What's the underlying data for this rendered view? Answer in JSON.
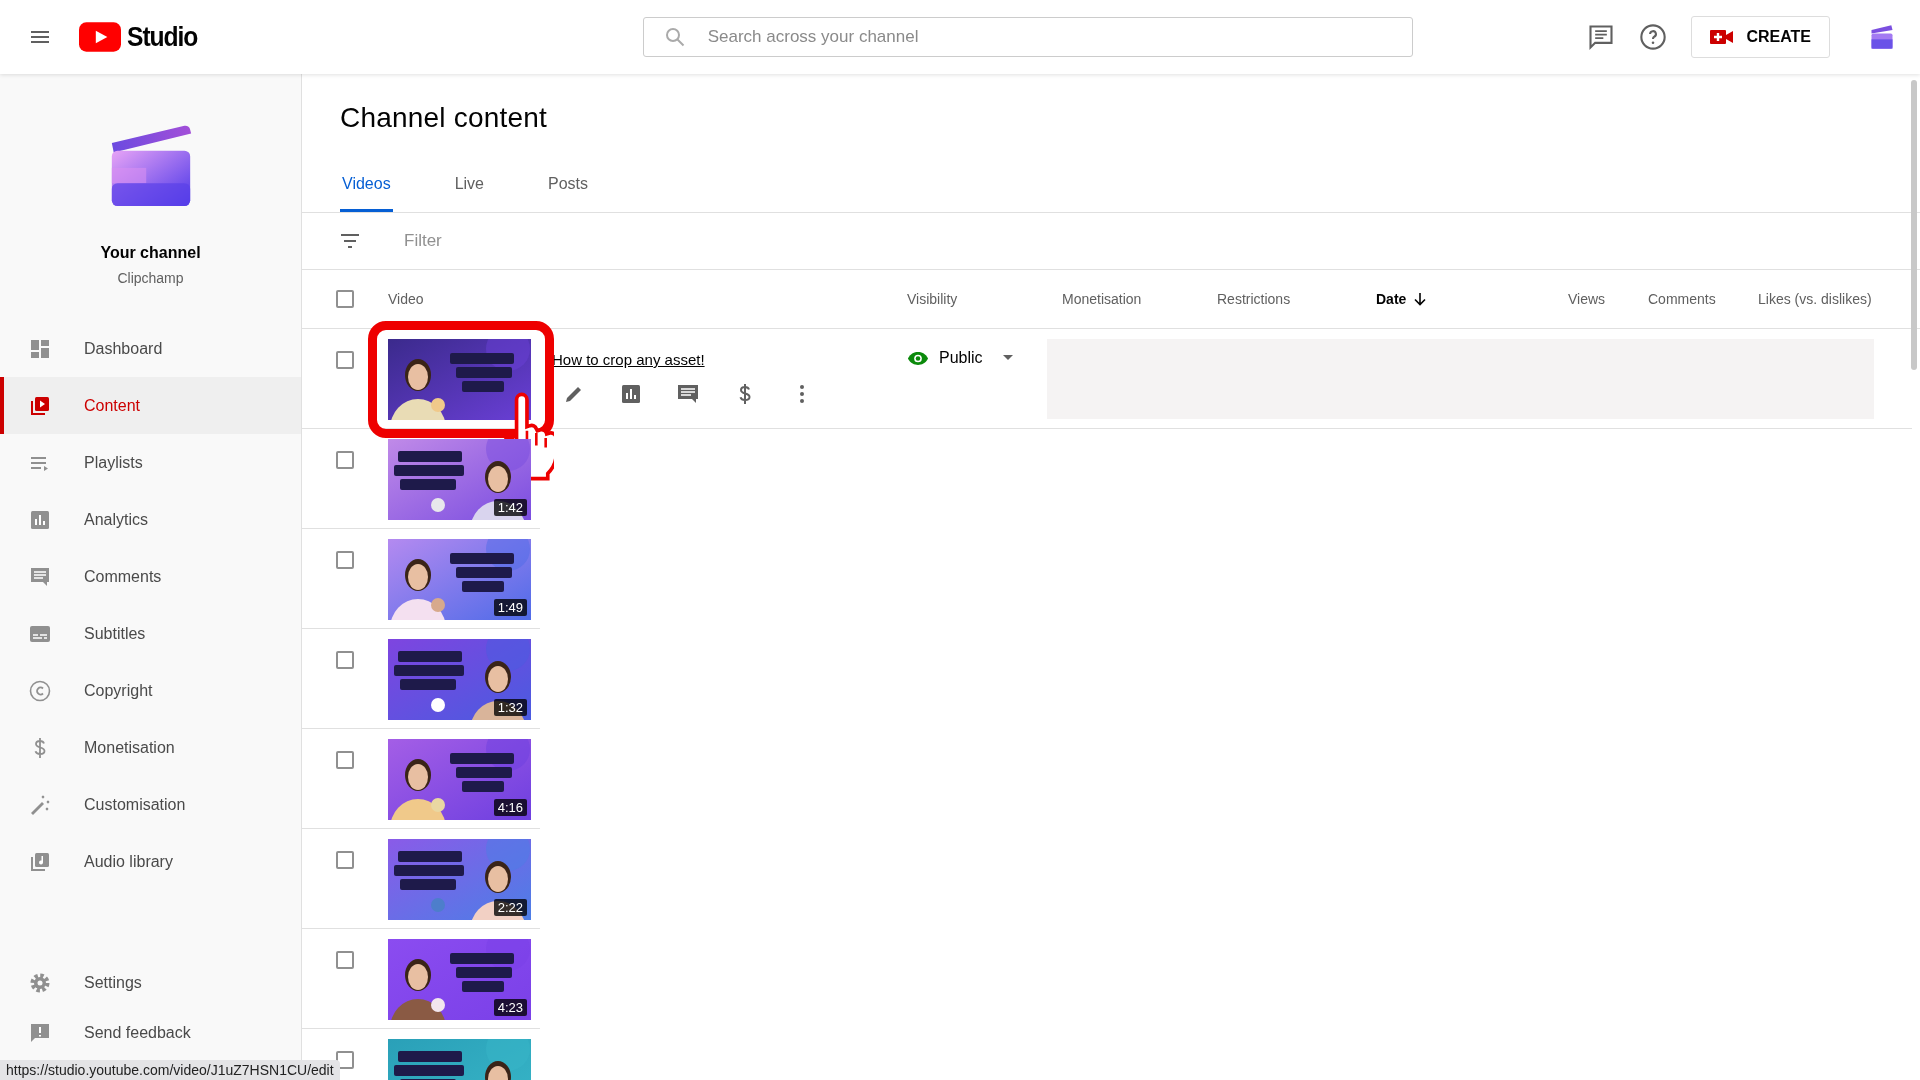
{
  "header": {
    "brand": "Studio",
    "search": {
      "placeholder": "Search across your channel"
    },
    "create_button": "CREATE"
  },
  "channel": {
    "name": "Your channel",
    "handle": "Clipchamp"
  },
  "sidebar": {
    "items": [
      {
        "label": "Dashboard",
        "selected": false
      },
      {
        "label": "Content",
        "selected": true
      },
      {
        "label": "Playlists",
        "selected": false
      },
      {
        "label": "Analytics",
        "selected": false
      },
      {
        "label": "Comments",
        "selected": false
      },
      {
        "label": "Subtitles",
        "selected": false
      },
      {
        "label": "Copyright",
        "selected": false
      },
      {
        "label": "Monetisation",
        "selected": false
      },
      {
        "label": "Customisation",
        "selected": false
      },
      {
        "label": "Audio library",
        "selected": false
      }
    ],
    "footer_items": [
      {
        "label": "Settings"
      },
      {
        "label": "Send feedback"
      }
    ]
  },
  "page": {
    "title": "Channel content",
    "tabs": [
      {
        "label": "Videos",
        "selected": true
      },
      {
        "label": "Live",
        "selected": false
      },
      {
        "label": "Posts",
        "selected": false
      }
    ],
    "filter": {
      "placeholder": "Filter"
    }
  },
  "table": {
    "select_all": {
      "checked": false
    },
    "columns": [
      {
        "label": "Video",
        "sorted": false
      },
      {
        "label": "Visibility",
        "sorted": false
      },
      {
        "label": "Monetisation",
        "sorted": false
      },
      {
        "label": "Restrictions",
        "sorted": false
      },
      {
        "label": "Date",
        "sorted": true
      },
      {
        "label": "Views",
        "sorted": false
      },
      {
        "label": "Comments",
        "sorted": false
      },
      {
        "label": "Likes (vs. dislikes)",
        "sorted": false
      }
    ],
    "rows": [
      {
        "checked": false,
        "hovered": true,
        "title": "How to crop any asset!",
        "visibility": "Public",
        "kind": "picture"
      },
      {
        "checked": false,
        "hovered": false,
        "duration": "1:42",
        "kind": "picture"
      },
      {
        "checked": false,
        "hovered": false,
        "duration": "1:49",
        "kind": "picture"
      },
      {
        "checked": false,
        "hovered": false,
        "duration": "1:32",
        "kind": "picture"
      },
      {
        "checked": false,
        "hovered": false,
        "duration": "4:16",
        "kind": "picture"
      },
      {
        "checked": false,
        "hovered": false,
        "duration": "2:22",
        "kind": "picture"
      },
      {
        "checked": false,
        "hovered": false,
        "duration": "4:23",
        "kind": "picture"
      },
      {
        "checked": false,
        "hovered": false,
        "kind": "picture"
      }
    ]
  },
  "status_bar": {
    "url": "https://studio.youtube.com/video/J1uZ7HSN1CU/edit"
  }
}
